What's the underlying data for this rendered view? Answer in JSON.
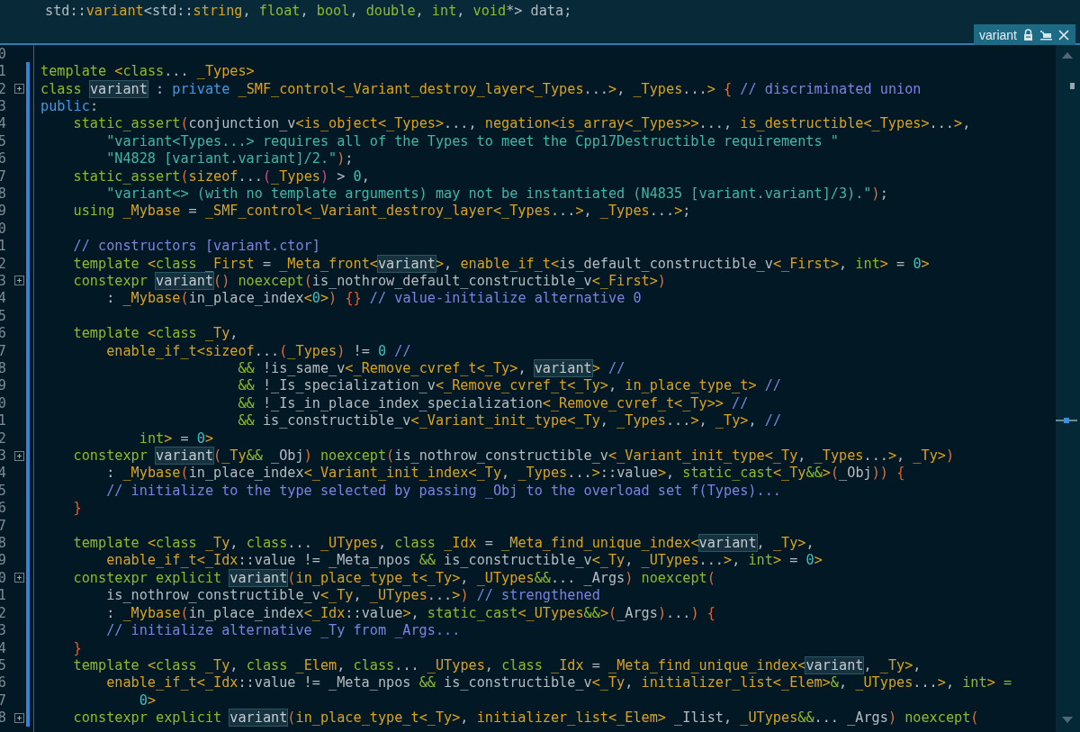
{
  "peek_header": {
    "tokens": [
      {
        "text": "std::",
        "kind": "p"
      },
      {
        "text": "variant",
        "kind": "t"
      },
      {
        "text": "<std::",
        "kind": "p"
      },
      {
        "text": "string",
        "kind": "t"
      },
      {
        "text": ", ",
        "kind": "p"
      },
      {
        "text": "float",
        "kind": "k"
      },
      {
        "text": ", ",
        "kind": "p"
      },
      {
        "text": "bool",
        "kind": "k"
      },
      {
        "text": ", ",
        "kind": "p"
      },
      {
        "text": "double",
        "kind": "k"
      },
      {
        "text": ", ",
        "kind": "p"
      },
      {
        "text": "int",
        "kind": "k"
      },
      {
        "text": ", ",
        "kind": "p"
      },
      {
        "text": "void",
        "kind": "k"
      },
      {
        "text": "*> data;",
        "kind": "p"
      }
    ]
  },
  "peek_tab": {
    "title": "variant"
  },
  "lines": [
    {
      "number": "0",
      "fold": false
    },
    {
      "number": "1",
      "fold": false,
      "tokens": [
        {
          "text": "template",
          "kind": "k"
        },
        {
          "text": " <",
          "kind": "t"
        },
        {
          "text": "class",
          "kind": "k"
        },
        {
          "text": "... ",
          "kind": "p"
        },
        {
          "text": "_Types>",
          "kind": "t"
        }
      ]
    },
    {
      "number": "2",
      "fold": true,
      "tokens": [
        {
          "text": "class ",
          "kind": "k"
        },
        {
          "text": "variant",
          "kind": "v"
        },
        {
          "text": " : ",
          "kind": "p"
        },
        {
          "text": "private",
          "kind": "b"
        },
        {
          "text": " _SMF_control<_Variant_destroy_layer<_Types",
          "kind": "t"
        },
        {
          "text": "...",
          "kind": "p"
        },
        {
          "text": ">",
          "kind": "t"
        },
        {
          "text": ", ",
          "kind": "p"
        },
        {
          "text": "_Types",
          "kind": "t"
        },
        {
          "text": "...",
          "kind": "p"
        },
        {
          "text": ">",
          "kind": "t"
        },
        {
          "text": " {",
          "kind": "r"
        },
        {
          "text": " // discriminated union",
          "kind": "c"
        }
      ]
    },
    {
      "number": "3",
      "fold": false,
      "tokens": [
        {
          "text": "public",
          "kind": "b"
        },
        {
          "text": ":",
          "kind": "p"
        }
      ]
    },
    {
      "number": "4",
      "fold": false,
      "tokens": [
        {
          "text": "    static_assert",
          "kind": "k"
        },
        {
          "text": "(",
          "kind": "r"
        },
        {
          "text": "conjunction_v",
          "kind": "p"
        },
        {
          "text": "<is_object<_Types>",
          "kind": "t"
        },
        {
          "text": "..., ",
          "kind": "p"
        },
        {
          "text": "negation<is_array<_Types>>",
          "kind": "t"
        },
        {
          "text": "..., ",
          "kind": "p"
        },
        {
          "text": "is_destructible<_Types>",
          "kind": "t"
        },
        {
          "text": "...",
          "kind": "p"
        },
        {
          "text": ">",
          "kind": "t"
        },
        {
          "text": ",",
          "kind": "p"
        }
      ]
    },
    {
      "number": "5",
      "fold": false,
      "tokens": [
        {
          "text": "        \"variant<Types...> requires all of the Types to meet the Cpp17Destructible requirements \"",
          "kind": "s"
        }
      ]
    },
    {
      "number": "6",
      "fold": false,
      "tokens": [
        {
          "text": "        \"N4828 [variant.variant]/2.\"",
          "kind": "s"
        },
        {
          "text": ")",
          "kind": "r"
        },
        {
          "text": ";",
          "kind": "p"
        }
      ]
    },
    {
      "number": "7",
      "fold": false,
      "tokens": [
        {
          "text": "    static_assert",
          "kind": "k"
        },
        {
          "text": "(",
          "kind": "r"
        },
        {
          "text": "sizeof",
          "kind": "t"
        },
        {
          "text": "...",
          "kind": "p"
        },
        {
          "text": "(",
          "kind": "m"
        },
        {
          "text": "_Types",
          "kind": "t"
        },
        {
          "text": ")",
          "kind": "m"
        },
        {
          "text": " > ",
          "kind": "p"
        },
        {
          "text": "0",
          "kind": "n"
        },
        {
          "text": ",",
          "kind": "p"
        }
      ]
    },
    {
      "number": "8",
      "fold": false,
      "tokens": [
        {
          "text": "        \"variant<> (with no template arguments) may not be instantiated (N4835 [variant.variant]/3).\"",
          "kind": "s"
        },
        {
          "text": ")",
          "kind": "r"
        },
        {
          "text": ";",
          "kind": "p"
        }
      ]
    },
    {
      "number": "9",
      "fold": false,
      "tokens": [
        {
          "text": "    using",
          "kind": "k"
        },
        {
          "text": " _Mybase",
          "kind": "t"
        },
        {
          "text": " = ",
          "kind": "p"
        },
        {
          "text": "_SMF_control<_Variant_destroy_layer<_Types",
          "kind": "t"
        },
        {
          "text": "...",
          "kind": "p"
        },
        {
          "text": ">",
          "kind": "t"
        },
        {
          "text": ", ",
          "kind": "p"
        },
        {
          "text": "_Types",
          "kind": "t"
        },
        {
          "text": "...",
          "kind": "p"
        },
        {
          "text": ">",
          "kind": "t"
        },
        {
          "text": ";",
          "kind": "p"
        }
      ]
    },
    {
      "number": "0",
      "fold": false
    },
    {
      "number": "1",
      "fold": false,
      "tokens": [
        {
          "text": "    // constructors [variant.ctor]",
          "kind": "c"
        }
      ]
    },
    {
      "number": "2",
      "fold": false,
      "tokens": [
        {
          "text": "    template",
          "kind": "k"
        },
        {
          "text": " <",
          "kind": "t"
        },
        {
          "text": "class",
          "kind": "k"
        },
        {
          "text": " _First",
          "kind": "t"
        },
        {
          "text": " = ",
          "kind": "p"
        },
        {
          "text": "_Meta_front<",
          "kind": "t"
        },
        {
          "text": "variant",
          "kind": "v"
        },
        {
          "text": ">",
          "kind": "t"
        },
        {
          "text": ", ",
          "kind": "p"
        },
        {
          "text": "enable_if_t<",
          "kind": "t"
        },
        {
          "text": "is_default_constructible_v",
          "kind": "p"
        },
        {
          "text": "<_First>",
          "kind": "t"
        },
        {
          "text": ", ",
          "kind": "p"
        },
        {
          "text": "int",
          "kind": "k"
        },
        {
          "text": ">",
          "kind": "t"
        },
        {
          "text": " = ",
          "kind": "p"
        },
        {
          "text": "0",
          "kind": "n"
        },
        {
          "text": ">",
          "kind": "t"
        }
      ]
    },
    {
      "number": "3",
      "fold": true,
      "tokens": [
        {
          "text": "    constexpr ",
          "kind": "k"
        },
        {
          "text": "variant",
          "kind": "v"
        },
        {
          "text": "()",
          "kind": "r"
        },
        {
          "text": " noexcept",
          "kind": "k"
        },
        {
          "text": "(",
          "kind": "r"
        },
        {
          "text": "is_nothrow_default_constructible_v",
          "kind": "p"
        },
        {
          "text": "<_First>",
          "kind": "t"
        },
        {
          "text": ")",
          "kind": "r"
        }
      ]
    },
    {
      "number": "4",
      "fold": false,
      "tokens": [
        {
          "text": "        : ",
          "kind": "p"
        },
        {
          "text": "_Mybase",
          "kind": "t"
        },
        {
          "text": "(",
          "kind": "r"
        },
        {
          "text": "in_place_index",
          "kind": "p"
        },
        {
          "text": "<",
          "kind": "t"
        },
        {
          "text": "0",
          "kind": "n"
        },
        {
          "text": ">",
          "kind": "t"
        },
        {
          "text": ")",
          "kind": "r"
        },
        {
          "text": " {}",
          "kind": "e"
        },
        {
          "text": " // value-initialize alternative 0",
          "kind": "c"
        }
      ]
    },
    {
      "number": "5",
      "fold": false
    },
    {
      "number": "6",
      "fold": false,
      "tokens": [
        {
          "text": "    template",
          "kind": "k"
        },
        {
          "text": " <",
          "kind": "t"
        },
        {
          "text": "class",
          "kind": "k"
        },
        {
          "text": " _Ty",
          "kind": "t"
        },
        {
          "text": ",",
          "kind": "p"
        }
      ]
    },
    {
      "number": "7",
      "fold": false,
      "tokens": [
        {
          "text": "        enable_if_t<",
          "kind": "t"
        },
        {
          "text": "sizeof",
          "kind": "t"
        },
        {
          "text": "...",
          "kind": "p"
        },
        {
          "text": "(",
          "kind": "r"
        },
        {
          "text": "_Types",
          "kind": "t"
        },
        {
          "text": ")",
          "kind": "r"
        },
        {
          "text": " != ",
          "kind": "p"
        },
        {
          "text": "0",
          "kind": "n"
        },
        {
          "text": " //",
          "kind": "c"
        }
      ]
    },
    {
      "number": "8",
      "fold": false,
      "tokens": [
        {
          "text": "                        &&",
          "kind": "k"
        },
        {
          "text": " !is_same_v",
          "kind": "p"
        },
        {
          "text": "<_Remove_cvref_t<_Ty>",
          "kind": "t"
        },
        {
          "text": ", ",
          "kind": "p"
        },
        {
          "text": "variant",
          "kind": "v"
        },
        {
          "text": ">",
          "kind": "t"
        },
        {
          "text": " //",
          "kind": "c"
        }
      ]
    },
    {
      "number": "9",
      "fold": false,
      "tokens": [
        {
          "text": "                        &&",
          "kind": "k"
        },
        {
          "text": " !_Is_specialization_v",
          "kind": "p"
        },
        {
          "text": "<_Remove_cvref_t<_Ty>",
          "kind": "t"
        },
        {
          "text": ", ",
          "kind": "p"
        },
        {
          "text": "in_place_type_t>",
          "kind": "t"
        },
        {
          "text": " //",
          "kind": "c"
        }
      ]
    },
    {
      "number": "0",
      "fold": false,
      "tokens": [
        {
          "text": "                        &&",
          "kind": "k"
        },
        {
          "text": " !_Is_in_place_index_specialization",
          "kind": "p"
        },
        {
          "text": "<_Remove_cvref_t<_Ty>>",
          "kind": "t"
        },
        {
          "text": " //",
          "kind": "c"
        }
      ]
    },
    {
      "number": "1",
      "fold": false,
      "tokens": [
        {
          "text": "                        &&",
          "kind": "k"
        },
        {
          "text": " is_constructible_v",
          "kind": "p"
        },
        {
          "text": "<_Variant_init_type<_Ty",
          "kind": "t"
        },
        {
          "text": ", ",
          "kind": "p"
        },
        {
          "text": "_Types",
          "kind": "t"
        },
        {
          "text": "...",
          "kind": "p"
        },
        {
          "text": ">",
          "kind": "t"
        },
        {
          "text": ", ",
          "kind": "p"
        },
        {
          "text": "_Ty>",
          "kind": "t"
        },
        {
          "text": ", ",
          "kind": "p"
        },
        {
          "text": "//",
          "kind": "c"
        }
      ]
    },
    {
      "number": "2",
      "fold": false,
      "tokens": [
        {
          "text": "            int",
          "kind": "k"
        },
        {
          "text": ">",
          "kind": "t"
        },
        {
          "text": " = ",
          "kind": "p"
        },
        {
          "text": "0",
          "kind": "n"
        },
        {
          "text": ">",
          "kind": "t"
        }
      ]
    },
    {
      "number": "3",
      "fold": true,
      "tokens": [
        {
          "text": "    constexpr ",
          "kind": "k"
        },
        {
          "text": "variant",
          "kind": "v"
        },
        {
          "text": "(",
          "kind": "r"
        },
        {
          "text": "_Ty",
          "kind": "t"
        },
        {
          "text": "&&",
          "kind": "k"
        },
        {
          "text": " _Obj",
          "kind": "p"
        },
        {
          "text": ")",
          "kind": "r"
        },
        {
          "text": " noexcept",
          "kind": "k"
        },
        {
          "text": "(",
          "kind": "r"
        },
        {
          "text": "is_nothrow_constructible_v",
          "kind": "p"
        },
        {
          "text": "<_Variant_init_type<_Ty",
          "kind": "t"
        },
        {
          "text": ", ",
          "kind": "p"
        },
        {
          "text": "_Types",
          "kind": "t"
        },
        {
          "text": "...",
          "kind": "p"
        },
        {
          "text": ">",
          "kind": "t"
        },
        {
          "text": ", ",
          "kind": "p"
        },
        {
          "text": "_Ty>",
          "kind": "t"
        },
        {
          "text": ")",
          "kind": "r"
        }
      ]
    },
    {
      "number": "4",
      "fold": false,
      "tokens": [
        {
          "text": "        : ",
          "kind": "p"
        },
        {
          "text": "_Mybase",
          "kind": "t"
        },
        {
          "text": "(",
          "kind": "r"
        },
        {
          "text": "in_place_index",
          "kind": "p"
        },
        {
          "text": "<_Variant_init_index<_Ty",
          "kind": "t"
        },
        {
          "text": ", ",
          "kind": "p"
        },
        {
          "text": "_Types",
          "kind": "t"
        },
        {
          "text": "...",
          "kind": "p"
        },
        {
          "text": ">",
          "kind": "t"
        },
        {
          "text": "::value",
          "kind": "p"
        },
        {
          "text": ">",
          "kind": "t"
        },
        {
          "text": ", ",
          "kind": "p"
        },
        {
          "text": "static_cast",
          "kind": "k"
        },
        {
          "text": "<_Ty",
          "kind": "t"
        },
        {
          "text": "&&",
          "kind": "k"
        },
        {
          "text": ">",
          "kind": "t"
        },
        {
          "text": "(",
          "kind": "r"
        },
        {
          "text": "_Obj",
          "kind": "p"
        },
        {
          "text": "))",
          "kind": "r"
        },
        {
          "text": " {",
          "kind": "e"
        }
      ]
    },
    {
      "number": "5",
      "fold": false,
      "tokens": [
        {
          "text": "        // initialize to the type selected by passing _Obj to the overload set f(Types)...",
          "kind": "c"
        }
      ]
    },
    {
      "number": "6",
      "fold": false,
      "tokens": [
        {
          "text": "    }",
          "kind": "e"
        }
      ]
    },
    {
      "number": "7",
      "fold": false
    },
    {
      "number": "8",
      "fold": false,
      "tokens": [
        {
          "text": "    template",
          "kind": "k"
        },
        {
          "text": " <",
          "kind": "t"
        },
        {
          "text": "class",
          "kind": "k"
        },
        {
          "text": " _Ty",
          "kind": "t"
        },
        {
          "text": ", ",
          "kind": "p"
        },
        {
          "text": "class",
          "kind": "k"
        },
        {
          "text": "... ",
          "kind": "p"
        },
        {
          "text": "_UTypes",
          "kind": "t"
        },
        {
          "text": ", ",
          "kind": "p"
        },
        {
          "text": "class",
          "kind": "k"
        },
        {
          "text": " _Idx",
          "kind": "t"
        },
        {
          "text": " = ",
          "kind": "p"
        },
        {
          "text": "_Meta_find_unique_index<",
          "kind": "t"
        },
        {
          "text": "variant",
          "kind": "v"
        },
        {
          "text": ", ",
          "kind": "p"
        },
        {
          "text": "_Ty>",
          "kind": "t"
        },
        {
          "text": ",",
          "kind": "p"
        }
      ]
    },
    {
      "number": "9",
      "fold": false,
      "tokens": [
        {
          "text": "        enable_if_t<_Idx",
          "kind": "t"
        },
        {
          "text": "::value != _Meta_npos ",
          "kind": "p"
        },
        {
          "text": "&&",
          "kind": "k"
        },
        {
          "text": " is_constructible_v",
          "kind": "p"
        },
        {
          "text": "<_Ty",
          "kind": "t"
        },
        {
          "text": ", ",
          "kind": "p"
        },
        {
          "text": "_UTypes",
          "kind": "t"
        },
        {
          "text": "...",
          "kind": "p"
        },
        {
          "text": ">",
          "kind": "t"
        },
        {
          "text": ", ",
          "kind": "p"
        },
        {
          "text": "int",
          "kind": "k"
        },
        {
          "text": ">",
          "kind": "t"
        },
        {
          "text": " = ",
          "kind": "p"
        },
        {
          "text": "0",
          "kind": "n"
        },
        {
          "text": ">",
          "kind": "t"
        }
      ]
    },
    {
      "number": "0",
      "fold": true,
      "tokens": [
        {
          "text": "    constexpr explicit ",
          "kind": "k"
        },
        {
          "text": "variant",
          "kind": "v"
        },
        {
          "text": "(",
          "kind": "r"
        },
        {
          "text": "in_place_type_t<_Ty>",
          "kind": "t"
        },
        {
          "text": ", ",
          "kind": "p"
        },
        {
          "text": "_UTypes",
          "kind": "t"
        },
        {
          "text": "&&",
          "kind": "k"
        },
        {
          "text": "... _Args",
          "kind": "p"
        },
        {
          "text": ")",
          "kind": "r"
        },
        {
          "text": " noexcept",
          "kind": "k"
        },
        {
          "text": "(",
          "kind": "r"
        }
      ]
    },
    {
      "number": "1",
      "fold": false,
      "tokens": [
        {
          "text": "        is_nothrow_constructible_v",
          "kind": "p"
        },
        {
          "text": "<_Ty",
          "kind": "t"
        },
        {
          "text": ", ",
          "kind": "p"
        },
        {
          "text": "_UTypes",
          "kind": "t"
        },
        {
          "text": "...",
          "kind": "p"
        },
        {
          "text": ">",
          "kind": "t"
        },
        {
          "text": ")",
          "kind": "r"
        },
        {
          "text": " // strengthened",
          "kind": "c"
        }
      ]
    },
    {
      "number": "2",
      "fold": false,
      "tokens": [
        {
          "text": "        : ",
          "kind": "p"
        },
        {
          "text": "_Mybase",
          "kind": "t"
        },
        {
          "text": "(",
          "kind": "r"
        },
        {
          "text": "in_place_index",
          "kind": "p"
        },
        {
          "text": "<_Idx",
          "kind": "t"
        },
        {
          "text": "::value",
          "kind": "p"
        },
        {
          "text": ">",
          "kind": "t"
        },
        {
          "text": ", ",
          "kind": "p"
        },
        {
          "text": "static_cast",
          "kind": "k"
        },
        {
          "text": "<_UTypes",
          "kind": "t"
        },
        {
          "text": "&&",
          "kind": "k"
        },
        {
          "text": ">",
          "kind": "t"
        },
        {
          "text": "(",
          "kind": "r"
        },
        {
          "text": "_Args",
          "kind": "p"
        },
        {
          "text": ")",
          "kind": "r"
        },
        {
          "text": "...",
          "kind": "p"
        },
        {
          "text": ")",
          "kind": "r"
        },
        {
          "text": " {",
          "kind": "e"
        }
      ]
    },
    {
      "number": "3",
      "fold": false,
      "tokens": [
        {
          "text": "        // initialize alternative _Ty from _Args...",
          "kind": "c"
        }
      ]
    },
    {
      "number": "4",
      "fold": false,
      "tokens": [
        {
          "text": "    }",
          "kind": "e"
        }
      ]
    },
    {
      "number": "5",
      "fold": false,
      "tokens": [
        {
          "text": "    template",
          "kind": "k"
        },
        {
          "text": " <",
          "kind": "t"
        },
        {
          "text": "class",
          "kind": "k"
        },
        {
          "text": " _Ty",
          "kind": "t"
        },
        {
          "text": ", ",
          "kind": "p"
        },
        {
          "text": "class",
          "kind": "k"
        },
        {
          "text": " _Elem",
          "kind": "t"
        },
        {
          "text": ", ",
          "kind": "p"
        },
        {
          "text": "class",
          "kind": "k"
        },
        {
          "text": "... ",
          "kind": "p"
        },
        {
          "text": "_UTypes",
          "kind": "t"
        },
        {
          "text": ", ",
          "kind": "p"
        },
        {
          "text": "class",
          "kind": "k"
        },
        {
          "text": " _Idx",
          "kind": "t"
        },
        {
          "text": " = ",
          "kind": "p"
        },
        {
          "text": "_Meta_find_unique_index<",
          "kind": "t"
        },
        {
          "text": "variant",
          "kind": "v"
        },
        {
          "text": ", ",
          "kind": "p"
        },
        {
          "text": "_Ty>",
          "kind": "t"
        },
        {
          "text": ",",
          "kind": "p"
        }
      ]
    },
    {
      "number": "6",
      "fold": false,
      "tokens": [
        {
          "text": "        enable_if_t<_Idx",
          "kind": "t"
        },
        {
          "text": "::value != _Meta_npos ",
          "kind": "p"
        },
        {
          "text": "&&",
          "kind": "k"
        },
        {
          "text": " is_constructible_v",
          "kind": "p"
        },
        {
          "text": "<_Ty",
          "kind": "t"
        },
        {
          "text": ", ",
          "kind": "p"
        },
        {
          "text": "initializer_list<_Elem>",
          "kind": "t"
        },
        {
          "text": "&",
          "kind": "k"
        },
        {
          "text": ", ",
          "kind": "p"
        },
        {
          "text": "_UTypes",
          "kind": "t"
        },
        {
          "text": "...",
          "kind": "p"
        },
        {
          "text": ">",
          "kind": "t"
        },
        {
          "text": ", ",
          "kind": "p"
        },
        {
          "text": "int",
          "kind": "k"
        },
        {
          "text": ">",
          "kind": "t"
        },
        {
          "text": " =",
          "kind": "k"
        }
      ]
    },
    {
      "number": "7",
      "fold": false,
      "tokens": [
        {
          "text": "            0",
          "kind": "n"
        },
        {
          "text": ">",
          "kind": "t"
        }
      ]
    },
    {
      "number": "8",
      "fold": true,
      "tokens": [
        {
          "text": "    constexpr explicit ",
          "kind": "k"
        },
        {
          "text": "variant",
          "kind": "v"
        },
        {
          "text": "(",
          "kind": "r"
        },
        {
          "text": "in_place_type_t<_Ty>",
          "kind": "t"
        },
        {
          "text": ", ",
          "kind": "p"
        },
        {
          "text": "initializer_list<_Elem>",
          "kind": "t"
        },
        {
          "text": " _Ilist, ",
          "kind": "p"
        },
        {
          "text": "_UTypes",
          "kind": "t"
        },
        {
          "text": "&&",
          "kind": "k"
        },
        {
          "text": "... _Args",
          "kind": "p"
        },
        {
          "text": ")",
          "kind": "r"
        },
        {
          "text": " noexcept",
          "kind": "k"
        },
        {
          "text": "(",
          "kind": "r"
        }
      ]
    }
  ]
}
